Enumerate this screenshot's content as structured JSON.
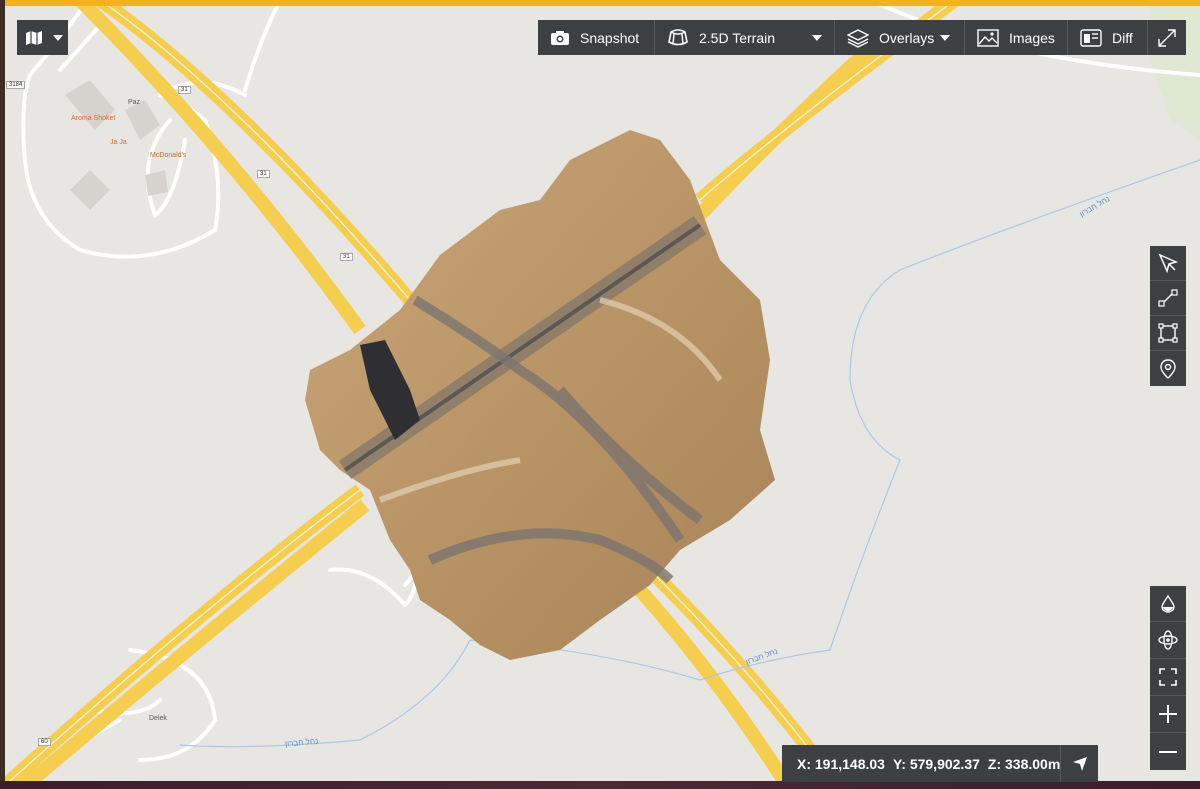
{
  "toolbar": {
    "basemap_icon": "map-icon",
    "snapshot_label": "Snapshot",
    "view_mode_label": "2.5D Terrain",
    "overlays_label": "Overlays",
    "images_label": "Images",
    "diff_label": "Diff"
  },
  "tools": {
    "top": [
      "select-icon",
      "measure-line-icon",
      "measure-area-icon",
      "pin-icon"
    ],
    "bottom": [
      "elevation-icon",
      "orbit-icon",
      "fit-view-icon",
      "zoom-in-icon",
      "zoom-out-icon"
    ]
  },
  "coords": {
    "x": "X: 191,148.03",
    "y": "Y: 579,902.37",
    "z": "Z: 338.00m"
  },
  "map_labels": {
    "route_3184": "3184",
    "route_31_a": "31",
    "route_31_b": "31",
    "route_31_c": "31",
    "route_60": "60",
    "paz": "Paz",
    "aroma": "Aroma Shoket",
    "jajaj": "Ja Ja",
    "mcdonalds": "McDonald's",
    "delek": "Delek",
    "stream_a": "נחל חברון",
    "stream_b": "נחל חברון",
    "stream_c": "נחל חברון"
  },
  "colors": {
    "toolbar_bg": "#3c4043",
    "accent": "#f3b21b",
    "highway": "#f5cd4f",
    "map_bg": "#e8e6e2"
  }
}
